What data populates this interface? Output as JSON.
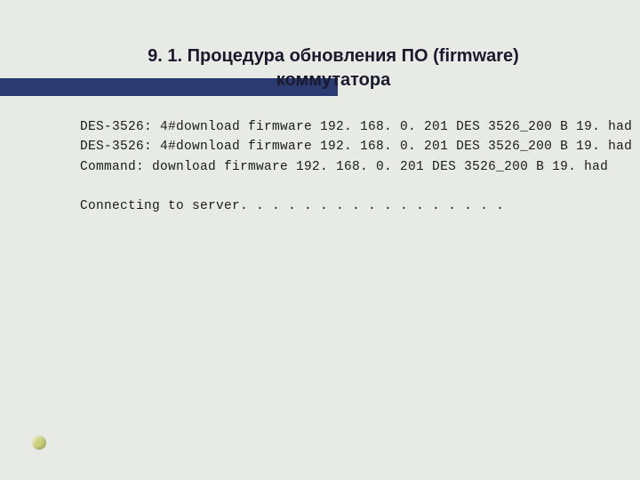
{
  "header": {
    "title_line1": "9. 1. Процедура обновления ПО (firmware)",
    "title_line2": "коммутатора"
  },
  "terminal": {
    "lines": [
      "DES-3526: 4#download firmware 192. 168. 0. 201 DES 3526_200 B 19. had",
      "DES-3526: 4#download firmware 192. 168. 0. 201 DES 3526_200 B 19. had",
      "Command: download firmware 192. 168. 0. 201 DES 3526_200 B 19. had"
    ],
    "status": "Connecting to server. . . . . . . . . . . . . . . . ."
  }
}
